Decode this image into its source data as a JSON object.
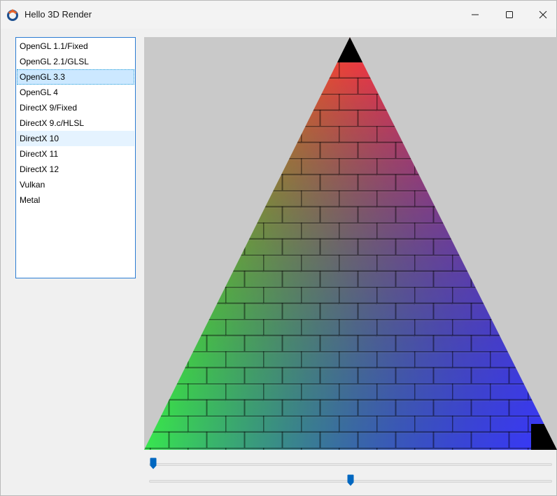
{
  "window": {
    "title": "Hello 3D Render",
    "icon": "app-ring-icon"
  },
  "caption_buttons": {
    "minimize_icon": "minimize-icon",
    "maximize_icon": "maximize-icon",
    "close_icon": "close-icon"
  },
  "renderer_list": {
    "items": [
      {
        "label": "OpenGL 1.1/Fixed"
      },
      {
        "label": "OpenGL 2.1/GLSL"
      },
      {
        "label": "OpenGL 3.3"
      },
      {
        "label": "OpenGL 4"
      },
      {
        "label": "DirectX 9/Fixed"
      },
      {
        "label": "DirectX 9.c/HLSL"
      },
      {
        "label": "DirectX 10"
      },
      {
        "label": "DirectX 11"
      },
      {
        "label": "DirectX 12"
      },
      {
        "label": "Vulkan"
      },
      {
        "label": "Metal"
      }
    ],
    "selected": "OpenGL 3.3",
    "hovered": "DirectX 10"
  },
  "viewport": {
    "background_color": "#c9c9c9",
    "vertex_colors": [
      "#ff0000",
      "#00ff00",
      "#0000ff"
    ],
    "texture": "brick"
  },
  "sliders": {
    "top_value": 0.0,
    "bottom_value": 0.5,
    "accent_color": "#0067c0"
  }
}
